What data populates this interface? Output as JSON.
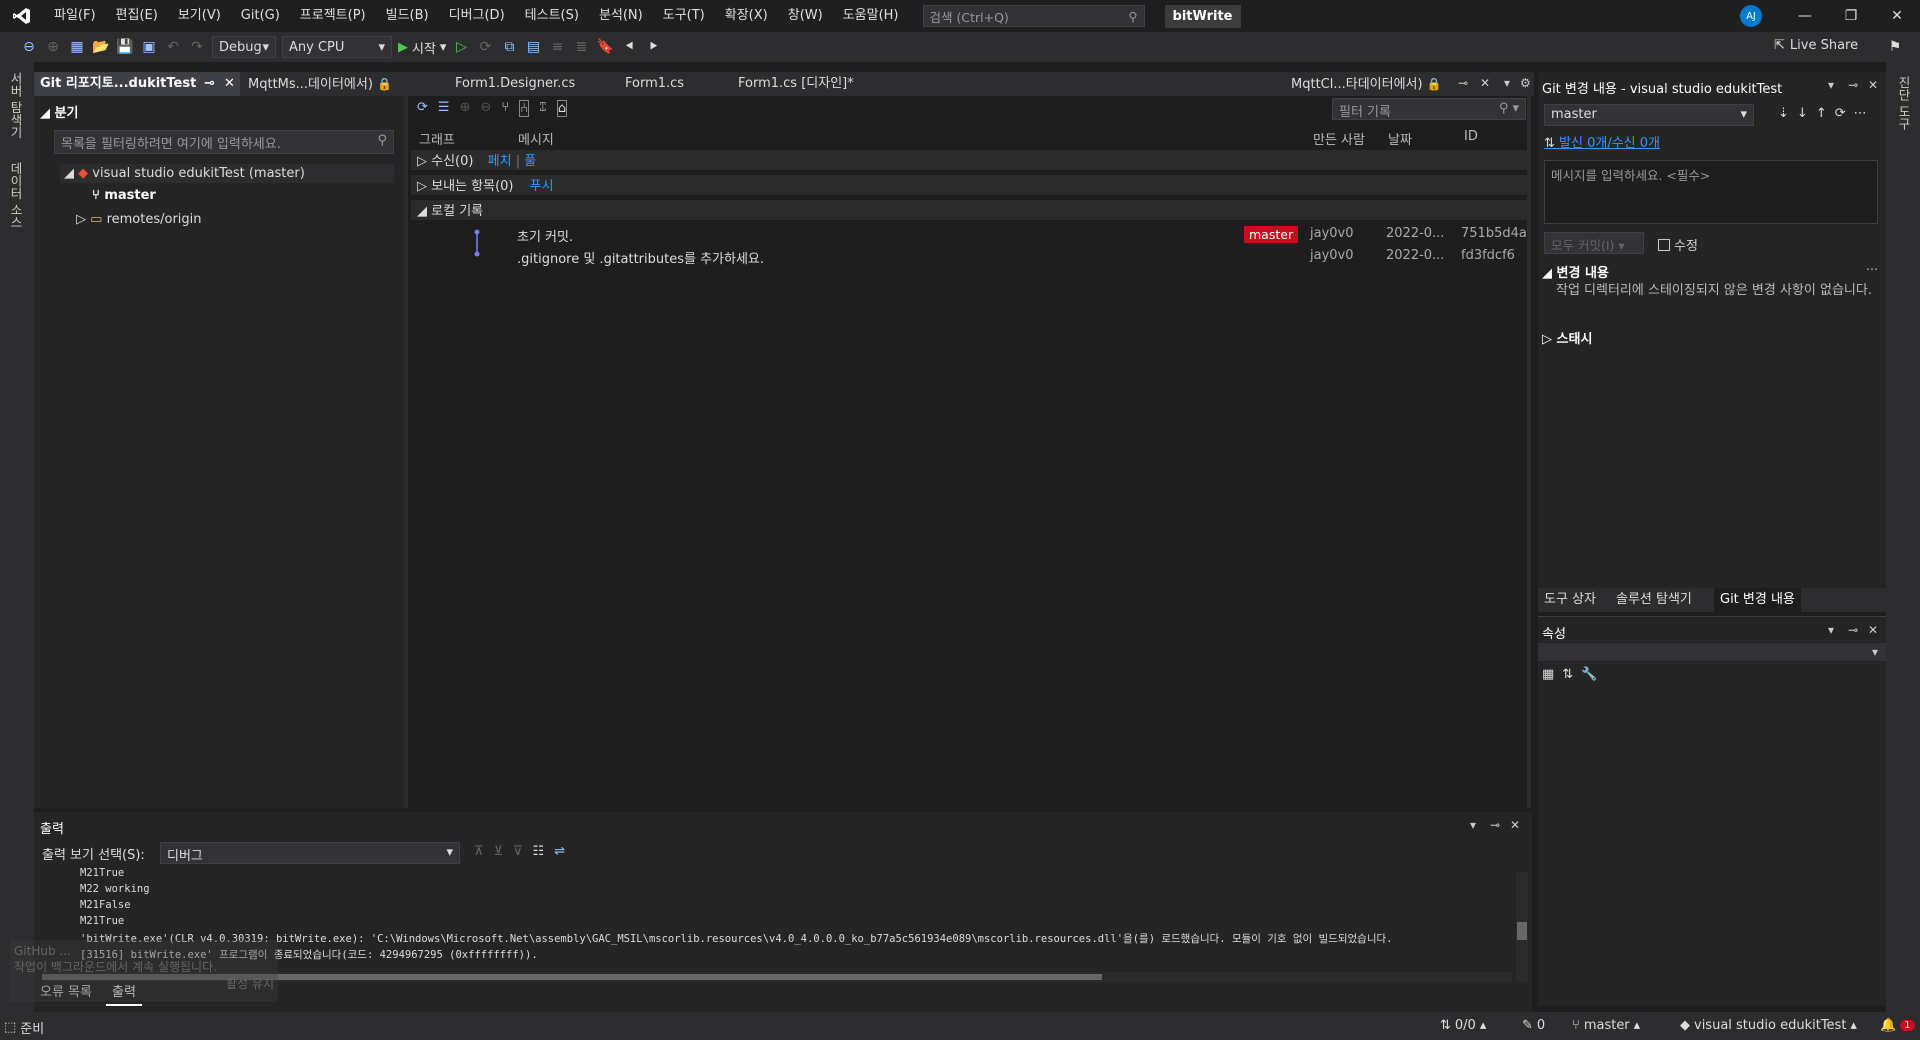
{
  "menubar": {
    "items": [
      "파일(F)",
      "편집(E)",
      "보기(V)",
      "Git(G)",
      "프로젝트(P)",
      "빌드(B)",
      "디버그(D)",
      "테스트(S)",
      "분석(N)",
      "도구(T)",
      "확장(X)",
      "창(W)",
      "도움말(H)"
    ],
    "search_placeholder": "검색 (Ctrl+Q)",
    "solution_title": "bitWrite",
    "avatar_initials": "AJ"
  },
  "toolbar": {
    "config": "Debug",
    "platform": "Any CPU",
    "start_label": "시작",
    "live_share": "Live Share"
  },
  "left_strip": {
    "tab1": "서버 탐색기",
    "tab2": "데이터 소스"
  },
  "right_strip": {
    "tab1": "진단 도구"
  },
  "doc_tabs": {
    "git_repo": "Git 리포지토...dukitTest",
    "mqttms": "MqttMs...데이터에서)",
    "form1_designer": "Form1.Designer.cs",
    "form1": "Form1.cs",
    "form1_design": "Form1.cs [디자인]*",
    "mqttcl": "MqttCl...타데이터에서)"
  },
  "branch_panel": {
    "title": "분기",
    "filter_placeholder": "목록을 필터링하려면 여기에 입력하세요.",
    "repo": "visual studio edukitTest (master)",
    "branch": "master",
    "remote": "remotes/origin"
  },
  "history": {
    "filter_placeholder": "필터 기록",
    "columns": {
      "graph": "그래프",
      "message": "메시지",
      "author": "만든 사람",
      "date": "날짜",
      "id": "ID"
    },
    "incoming": "수신(0)",
    "fetch": "페치",
    "pull": "풀",
    "outgoing": "보내는 항목(0)",
    "push": "푸시",
    "local": "로컬 기록",
    "commits": [
      {
        "message": "초기 커밋.",
        "branch": "master",
        "author": "jay0v0",
        "date": "2022-0...",
        "id": "751b5d4a"
      },
      {
        "message": ".gitignore 및 .gitattributes를 추가하세요.",
        "branch": "",
        "author": "jay0v0",
        "date": "2022-0...",
        "id": "fd3fdcf6"
      }
    ]
  },
  "git_changes": {
    "title": "Git 변경 내용 - visual studio edukitTest",
    "branch": "master",
    "sync": "발신 0개/수신 0개",
    "message_placeholder": "메시지를 입력하세요. <필수>",
    "commit_all": "모두 커밋(I)",
    "amend": "수정",
    "changes_title": "변경 내용",
    "changes_text": "작업 디렉터리에 스테이징되지 않은 변경 사항이 없습니다.",
    "stash": "스태시"
  },
  "pane_tabs": {
    "toolbox": "도구 상자",
    "solution": "솔루션 탐색기",
    "git": "Git 변경 내용"
  },
  "properties": {
    "title": "속성"
  },
  "output": {
    "title": "출력",
    "source_label": "출력 보기 선택(S):",
    "source": "디버그",
    "lines": [
      "M21True",
      "M22 working",
      "M21False",
      "M21True",
      "'bitWrite.exe'(CLR v4.0.30319: bitWrite.exe): 'C:\\Windows\\Microsoft.Net\\assembly\\GAC_MSIL\\mscorlib.resources\\v4.0_4.0.0.0_ko_b77a5c561934e089\\mscorlib.resources.dll'을(를) 로드했습니다. 모듈이 기호 없이 빌드되었습니다.",
      "[31516] bitWrite.exe' 프로그램이 종료되었습니다(코드: 4294967295 (0xffffffff))."
    ]
  },
  "bottom_tabs": {
    "errors": "오류 목록",
    "output": "출력"
  },
  "toast": {
    "line1": "GitHub ...",
    "line2": "작업이 백그라운드에서 계속 실행됩니다.",
    "action": "활성 유지"
  },
  "statusbar": {
    "ready": "준비",
    "sync": "0/0",
    "pencil_count": "0",
    "branch": "master",
    "repo": "visual studio edukitTest",
    "notif_count": "1"
  }
}
